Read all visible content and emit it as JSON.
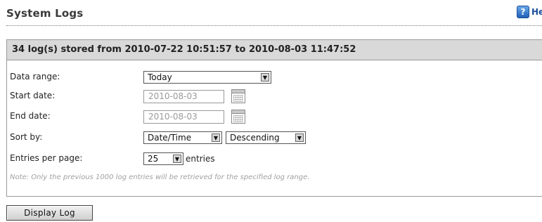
{
  "page": {
    "title": "System Logs",
    "help_label": "Help",
    "help_icon": "?"
  },
  "panel": {
    "header": "34 log(s) stored from 2010-07-22 10:51:57 to 2010-08-03 11:47:52"
  },
  "form": {
    "data_range_label": "Data range:",
    "data_range_value": "Today",
    "start_date_label": "Start date:",
    "start_date_value": "2010-08-03",
    "end_date_label": "End date:",
    "end_date_value": "2010-08-03",
    "sort_by_label": "Sort by:",
    "sort_field_value": "Date/Time",
    "sort_order_value": "Descending",
    "entries_label": "Entries per page:",
    "entries_value": "25",
    "entries_suffix": "entries",
    "note": "Note: Only the previous 1000 log entries will be retrieved for the specified log range."
  },
  "actions": {
    "display_log": "Display Log"
  },
  "colors": {
    "header_bg": "#d9d9d9",
    "help_blue": "#1a4f9c"
  },
  "icons": {
    "help": "help-icon",
    "calendar": "calendar-icon",
    "caret": "chevron-down-icon"
  }
}
